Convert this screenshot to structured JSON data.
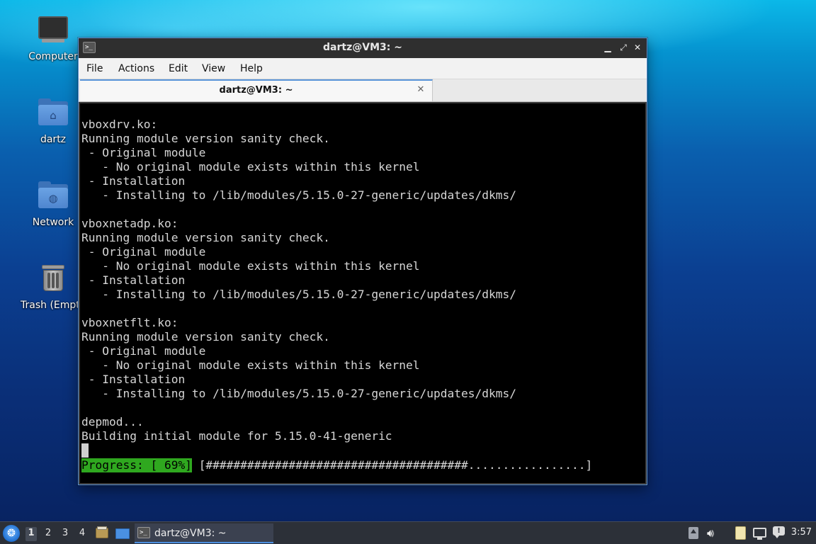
{
  "desktop": {
    "icons": [
      {
        "label": "Computer",
        "icon": "computer-icon"
      },
      {
        "label": "dartz",
        "icon": "home-folder-icon"
      },
      {
        "label": "Network",
        "icon": "network-folder-icon"
      },
      {
        "label": "Trash (Empty)",
        "icon": "trash-icon"
      }
    ]
  },
  "window": {
    "title": "dartz@VM3: ~",
    "controls": {
      "minimize": "▁",
      "maximize": "⤢",
      "close": "✕"
    },
    "menu": [
      "File",
      "Actions",
      "Edit",
      "View",
      "Help"
    ],
    "tab": {
      "label": "dartz@VM3: ~",
      "close": "✕"
    }
  },
  "terminal": {
    "lines": [
      "vboxdrv.ko:",
      "Running module version sanity check.",
      " - Original module",
      "   - No original module exists within this kernel",
      " - Installation",
      "   - Installing to /lib/modules/5.15.0-27-generic/updates/dkms/",
      "",
      "vboxnetadp.ko:",
      "Running module version sanity check.",
      " - Original module",
      "   - No original module exists within this kernel",
      " - Installation",
      "   - Installing to /lib/modules/5.15.0-27-generic/updates/dkms/",
      "",
      "vboxnetflt.ko:",
      "Running module version sanity check.",
      " - Original module",
      "   - No original module exists within this kernel",
      " - Installation",
      "   - Installing to /lib/modules/5.15.0-27-generic/updates/dkms/",
      "",
      "depmod...",
      "Building initial module for 5.15.0-41-generic"
    ],
    "progress_label": "Progress: [ 69%]",
    "progress_bar": "[######################################.................]",
    "progress_percent": 69,
    "colors": {
      "progress_bg": "#2fa81f",
      "text": "#d6d6d6",
      "background": "#000000"
    }
  },
  "taskbar": {
    "workspaces": [
      "1",
      "2",
      "3",
      "4"
    ],
    "active_workspace": "1",
    "quicklaunch": [
      "file-manager-icon",
      "show-desktop-icon"
    ],
    "task": {
      "label": "dartz@VM3: ~",
      "icon": "terminal-icon"
    },
    "tray": [
      "update-icon",
      "volume-icon",
      "clipboard-icon",
      "network-icon",
      "notification-icon"
    ],
    "clock": "3:57"
  }
}
